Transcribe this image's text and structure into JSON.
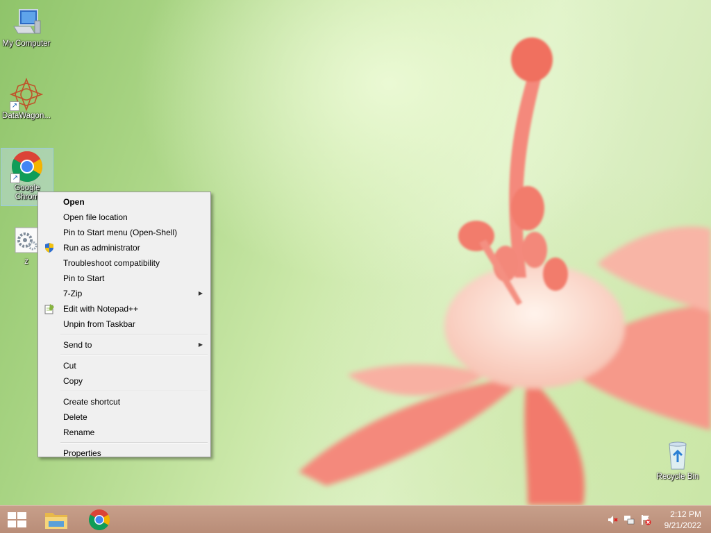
{
  "desktop_icons": [
    {
      "label": "My Computer",
      "icon": "computer-icon"
    },
    {
      "label": "DataWagon...",
      "icon": "datawagon-icon"
    },
    {
      "label_line1": "Google",
      "label_line2": "Chrom",
      "icon": "chrome-icon"
    },
    {
      "label": "z",
      "icon": "settings-file-icon"
    },
    {
      "label": "Recycle Bin",
      "icon": "recycle-bin-icon"
    }
  ],
  "context_menu": {
    "items": [
      {
        "label": "Open"
      },
      {
        "label": "Open file location"
      },
      {
        "label": "Pin to Start menu (Open-Shell)"
      },
      {
        "label": "Run as administrator",
        "icon": "uac-shield-icon"
      },
      {
        "label": "Troubleshoot compatibility"
      },
      {
        "label": "Pin to Start"
      },
      {
        "label": "7-Zip"
      },
      {
        "label": "Edit with Notepad++",
        "icon": "notepadpp-icon"
      },
      {
        "label": "Unpin from Taskbar"
      },
      {
        "label": "Send to"
      },
      {
        "label": "Cut"
      },
      {
        "label": "Copy"
      },
      {
        "label": "Create shortcut"
      },
      {
        "label": "Delete"
      },
      {
        "label": "Rename"
      },
      {
        "label": "Properties"
      }
    ],
    "submenu_arrow": "▶"
  },
  "taskbar": {
    "pinned": [
      "start-icon",
      "file-explorer-icon",
      "chrome-icon"
    ],
    "tray": [
      "volume-muted-icon",
      "network-icon",
      "action-center-icon"
    ],
    "time": "2:12 PM",
    "date": "9/21/2022"
  },
  "colors": {
    "taskbar": "#c0967f",
    "menu_background": "#f0f0f0",
    "selection": "#bedcf0"
  }
}
